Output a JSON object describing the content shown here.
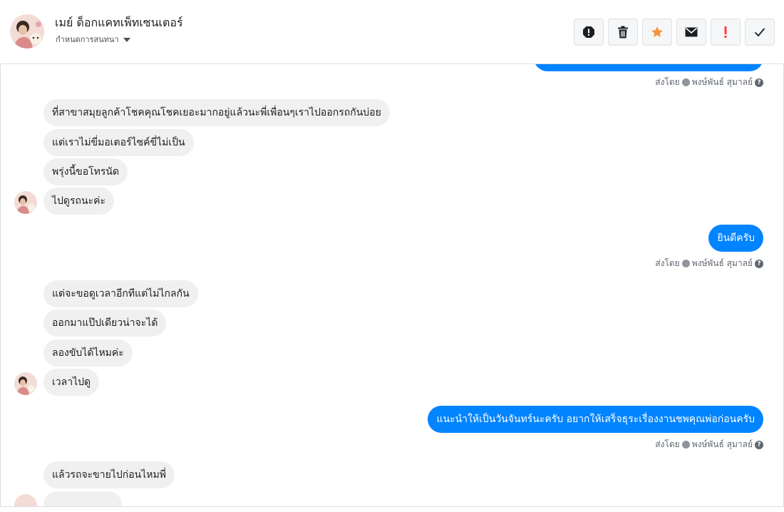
{
  "header": {
    "name": "เมย์ ด็อกแคทเพ็ทเซนเตอร์",
    "subtitle": "กำหนดการสนทนา",
    "toolbar": [
      {
        "name": "report-icon",
        "color": "#1c1e21"
      },
      {
        "name": "trash-icon",
        "color": "#1c1e21"
      },
      {
        "name": "star-icon",
        "color": "#f7923a"
      },
      {
        "name": "envelope-icon",
        "color": "#1c1e21"
      },
      {
        "name": "exclamation-icon",
        "color": "#fa3e3e"
      },
      {
        "name": "check-icon",
        "color": "#1c1e21"
      }
    ]
  },
  "sent_by": {
    "prefix": "ส่งโดย",
    "agent": "พงษ์พันธ์ สุมาลย์"
  },
  "messages": {
    "in_1": "ที่สาขาสมุยลูกค้าโชคคุณโชคเยอะมากอยู่แล้วนะพี่เพื่อนๆเราไปออกรถกันบ่อย",
    "in_2": "แต่เราไม่ขี่มอเตอร์ไซค์ขี่ไม่เป็น",
    "in_3": "พรุ่งนี้ขอโทรนัด",
    "in_4": "ไปดูรถนะค่ะ",
    "out_1": "ยินดีครับ",
    "in_5": "แต่จะขอดูเวลาอีกทีแต่ไม่ไกลกัน",
    "in_6": "ออกมาแป๊ปเดียวน่าจะได้",
    "in_7": "ลองขับได้ไหมค่ะ",
    "in_8": "เวลาไปดู",
    "out_2": "แนะนำให้เป็นวันจันทร์นะครับ อยากให้เสร็จธุระเรื่องงานชพคุณพ่อก่อนครับ",
    "in_9": "แล้วรถจะขายไปก่อนไหมพี่"
  },
  "colors": {
    "outgoing": "#0084ff",
    "incoming": "#f1f0f0",
    "accent_star": "#f7923a",
    "alert": "#fa3e3e"
  }
}
